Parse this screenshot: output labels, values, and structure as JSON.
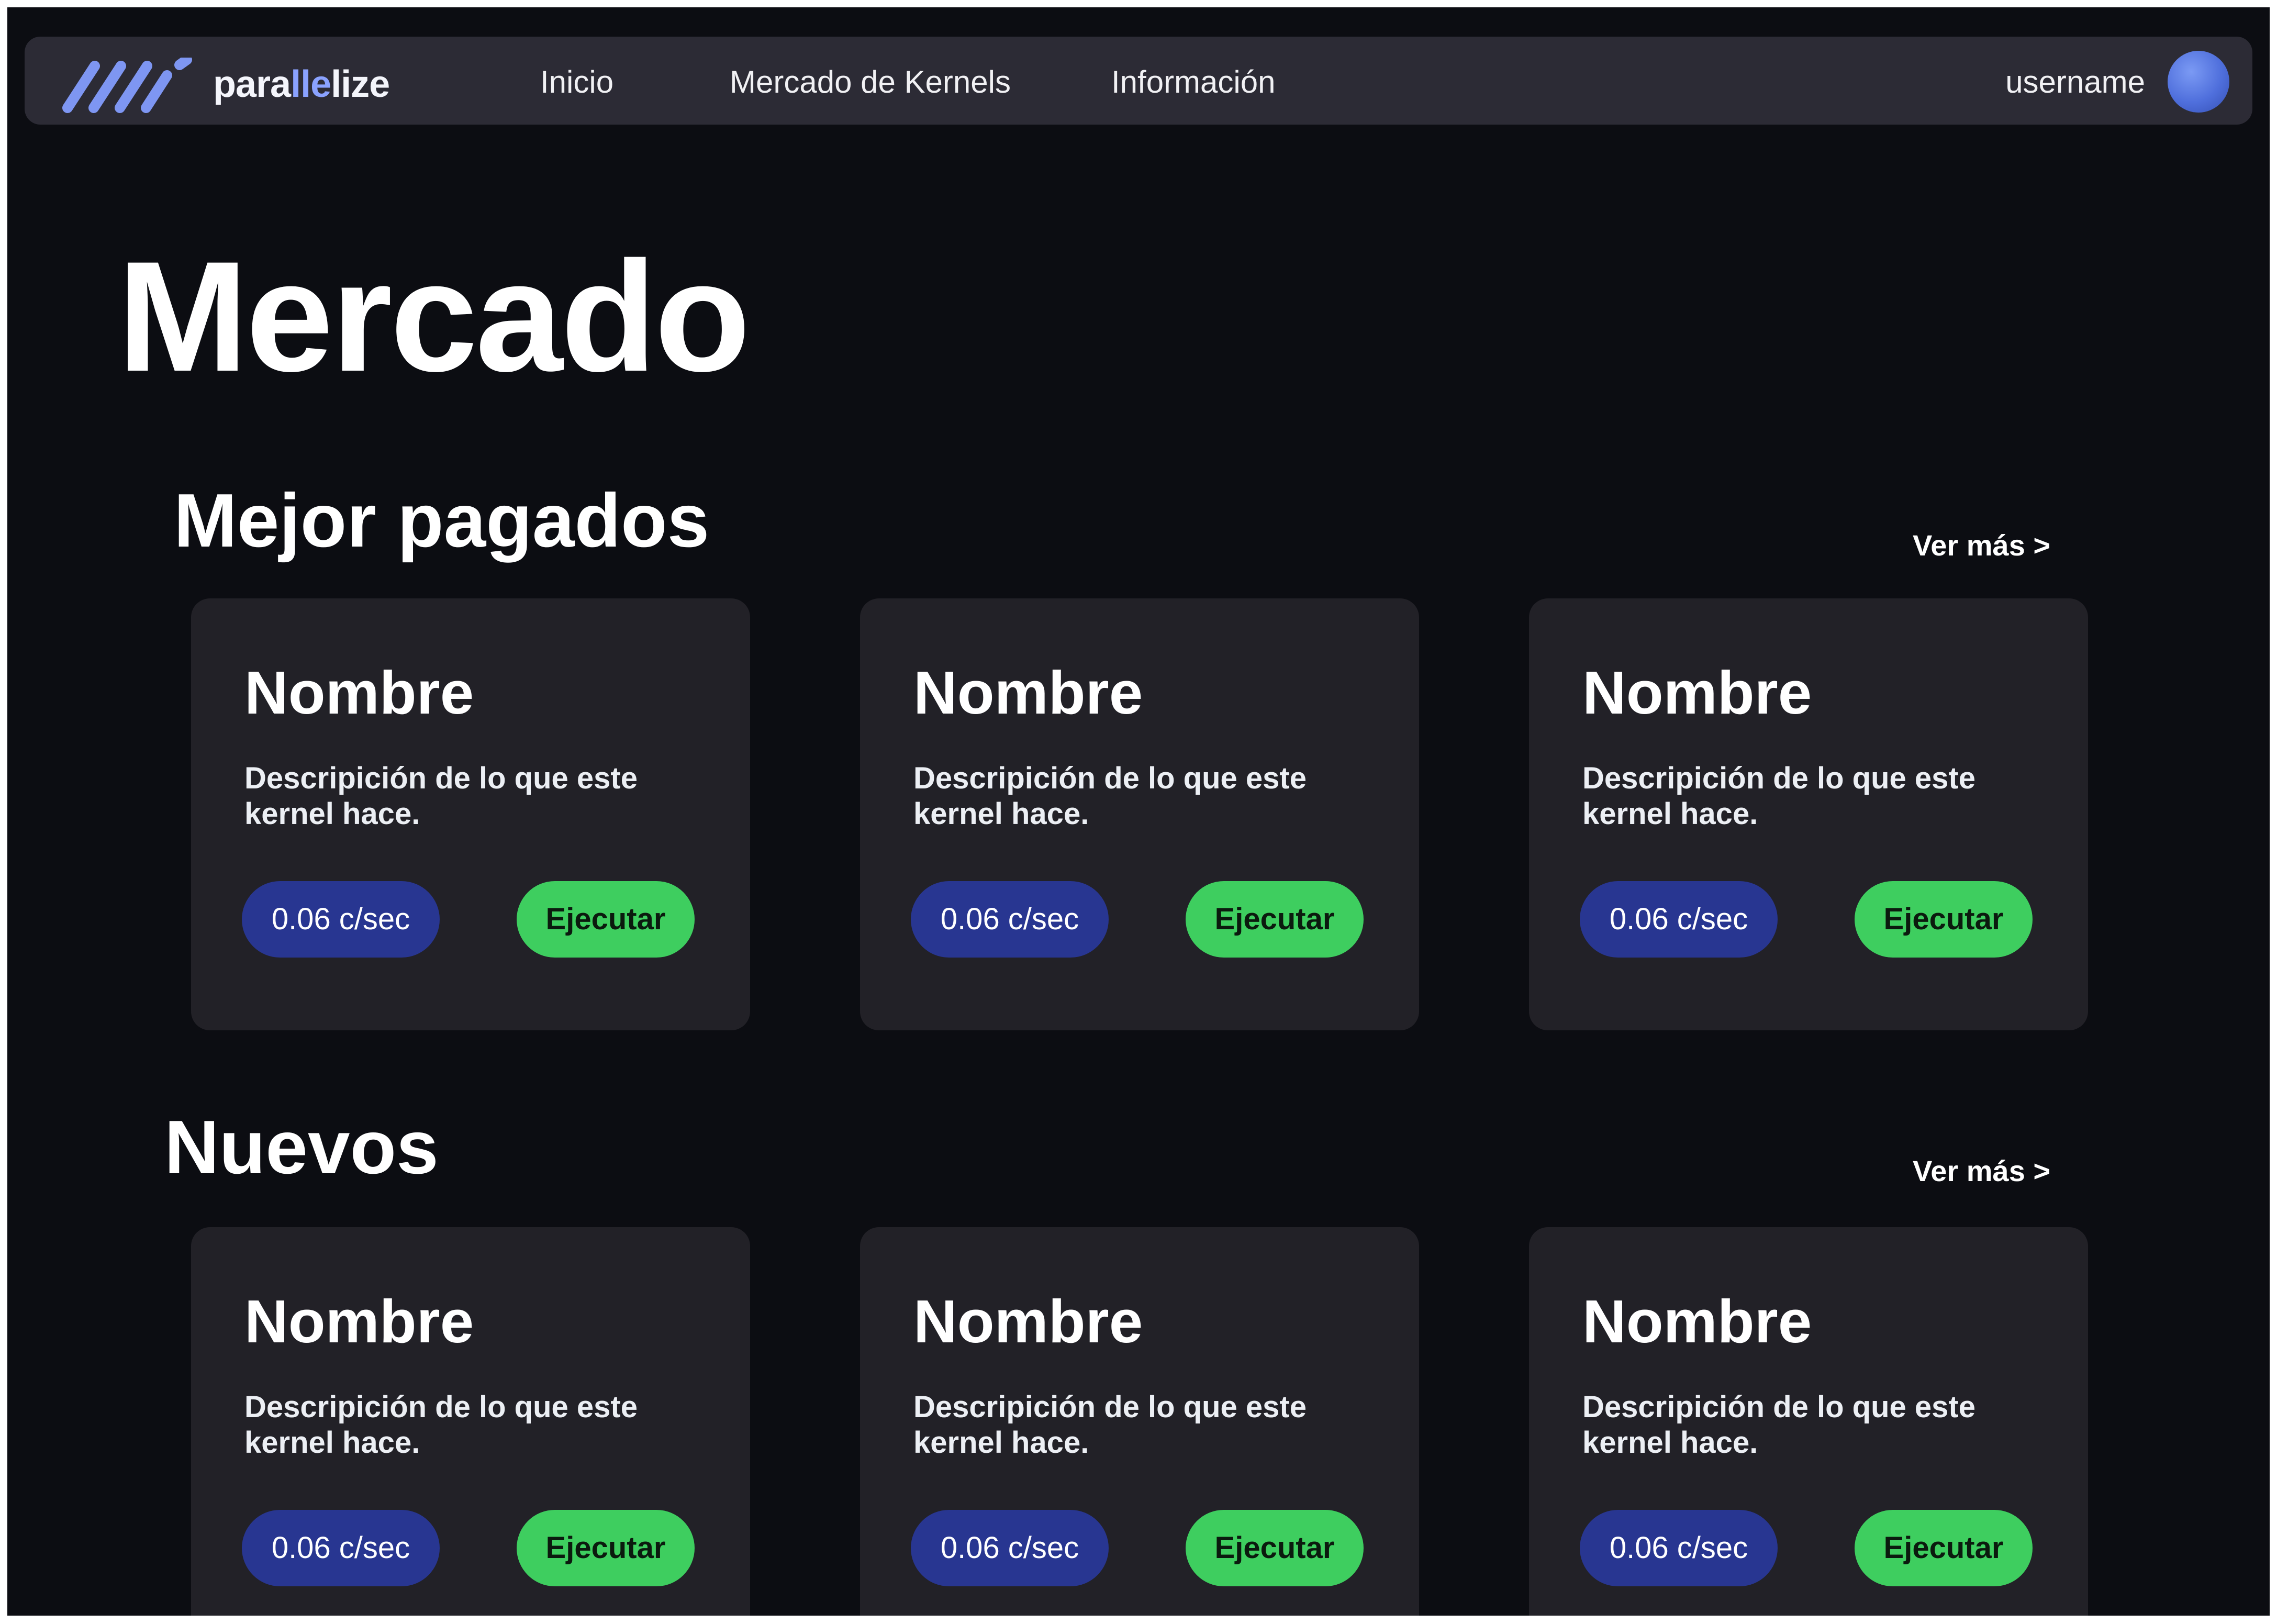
{
  "header": {
    "logo": {
      "prefix": "para",
      "highlight": "lle",
      "suffix": "lize",
      "mark_color": "#7e96f2",
      "highlight_color": "#8aa2ff"
    },
    "nav": {
      "inicio": "Inicio",
      "mercado": "Mercado de Kernels",
      "informacion": "Información"
    },
    "username": "username",
    "avatar_color": "#4f6fdc"
  },
  "main": {
    "title": "Mercado",
    "sections": [
      {
        "title": "Mejor pagados",
        "see_more": "Ver más >",
        "cards": [
          {
            "name": "Nombre",
            "description": "Descripición de lo que este kernel hace.",
            "price": "0.06 c/sec",
            "action": "Ejecutar"
          },
          {
            "name": "Nombre",
            "description": "Descripición de lo que este kernel hace.",
            "price": "0.06 c/sec",
            "action": "Ejecutar"
          },
          {
            "name": "Nombre",
            "description": "Descripición de lo que este kernel hace.",
            "price": "0.06 c/sec",
            "action": "Ejecutar"
          }
        ]
      },
      {
        "title": "Nuevos",
        "see_more": "Ver más >",
        "cards": [
          {
            "name": "Nombre",
            "description": "Descripición de lo que este kernel hace.",
            "price": "0.06 c/sec",
            "action": "Ejecutar"
          },
          {
            "name": "Nombre",
            "description": "Descripición de lo que este kernel hace.",
            "price": "0.06 c/sec",
            "action": "Ejecutar"
          },
          {
            "name": "Nombre",
            "description": "Descripición de lo que este kernel hace.",
            "price": "0.06 c/sec",
            "action": "Ejecutar"
          }
        ]
      }
    ]
  },
  "colors": {
    "background": "#0c0d12",
    "navbar": "#2c2b35",
    "card": "#222127",
    "price_pill": "#283691",
    "action_button": "#3ece5f"
  }
}
